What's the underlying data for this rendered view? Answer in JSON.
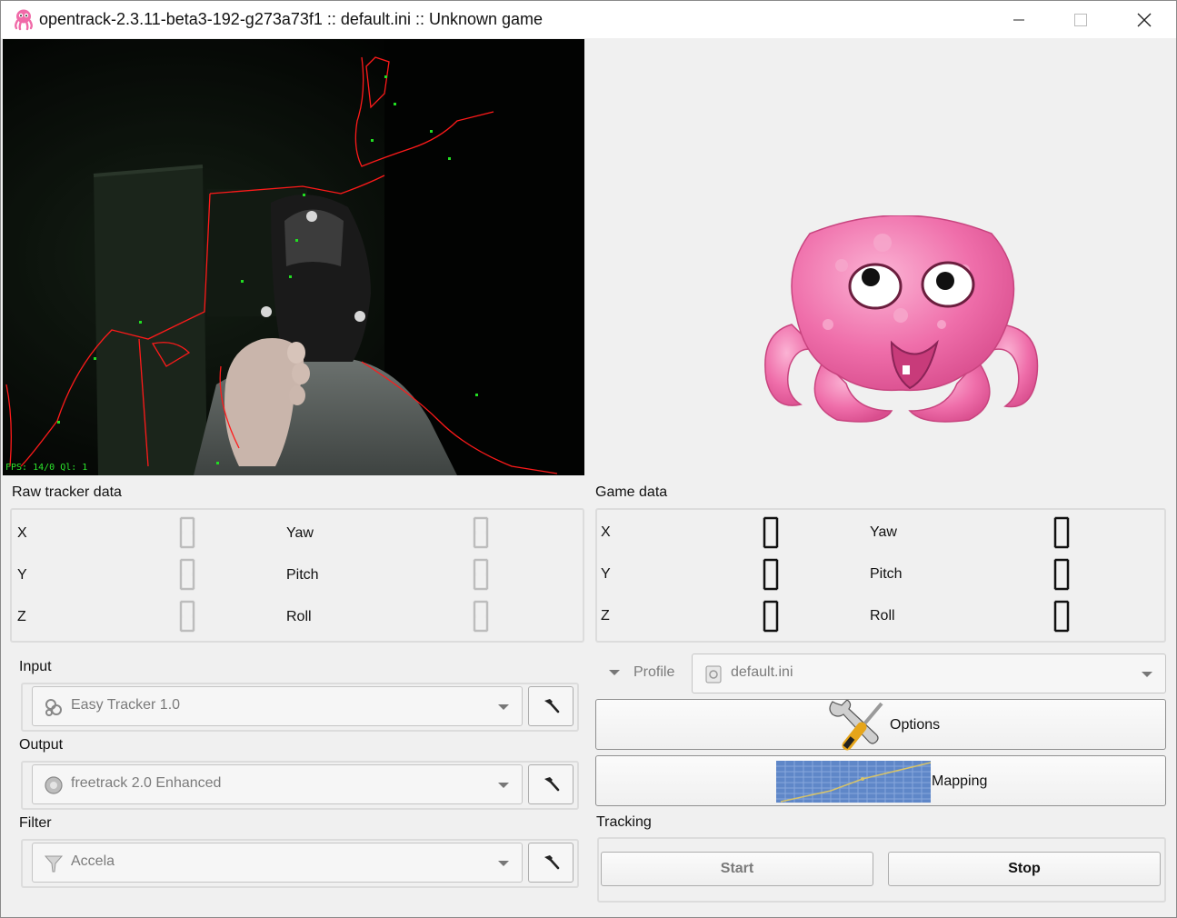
{
  "window": {
    "title": "opentrack-2.3.11-beta3-192-g273a73f1 :: default.ini :: Unknown game"
  },
  "video": {
    "overlay_text": "FPS: 14/0   Ql: 1"
  },
  "raw_tracker": {
    "title": "Raw tracker data",
    "labels": {
      "x": "X",
      "y": "Y",
      "z": "Z",
      "yaw": "Yaw",
      "pitch": "Pitch",
      "roll": "Roll"
    }
  },
  "game_data": {
    "title": "Game data",
    "labels": {
      "x": "X",
      "y": "Y",
      "z": "Z",
      "yaw": "Yaw",
      "pitch": "Pitch",
      "roll": "Roll"
    }
  },
  "modules": {
    "input": {
      "label": "Input",
      "value": "Easy Tracker 1.0"
    },
    "output": {
      "label": "Output",
      "value": "freetrack 2.0 Enhanced"
    },
    "filter": {
      "label": "Filter",
      "value": "Accela"
    }
  },
  "profile": {
    "label": "Profile",
    "value": "default.ini"
  },
  "buttons": {
    "options": "Options",
    "mapping": "Mapping"
  },
  "tracking": {
    "title": "Tracking",
    "start": "Start",
    "stop": "Stop"
  },
  "icons": {
    "app": "octopus-icon",
    "minimize": "minimize-icon",
    "maximize": "maximize-icon",
    "close": "close-icon",
    "settings": "hammer-icon",
    "options": "wrench-screwdriver-icon",
    "mapping": "curve-graph-icon"
  },
  "colors": {
    "tracker_outline": "#ff1a1a",
    "tracker_points": "#22dd22",
    "octopus": "#f06aa8"
  }
}
